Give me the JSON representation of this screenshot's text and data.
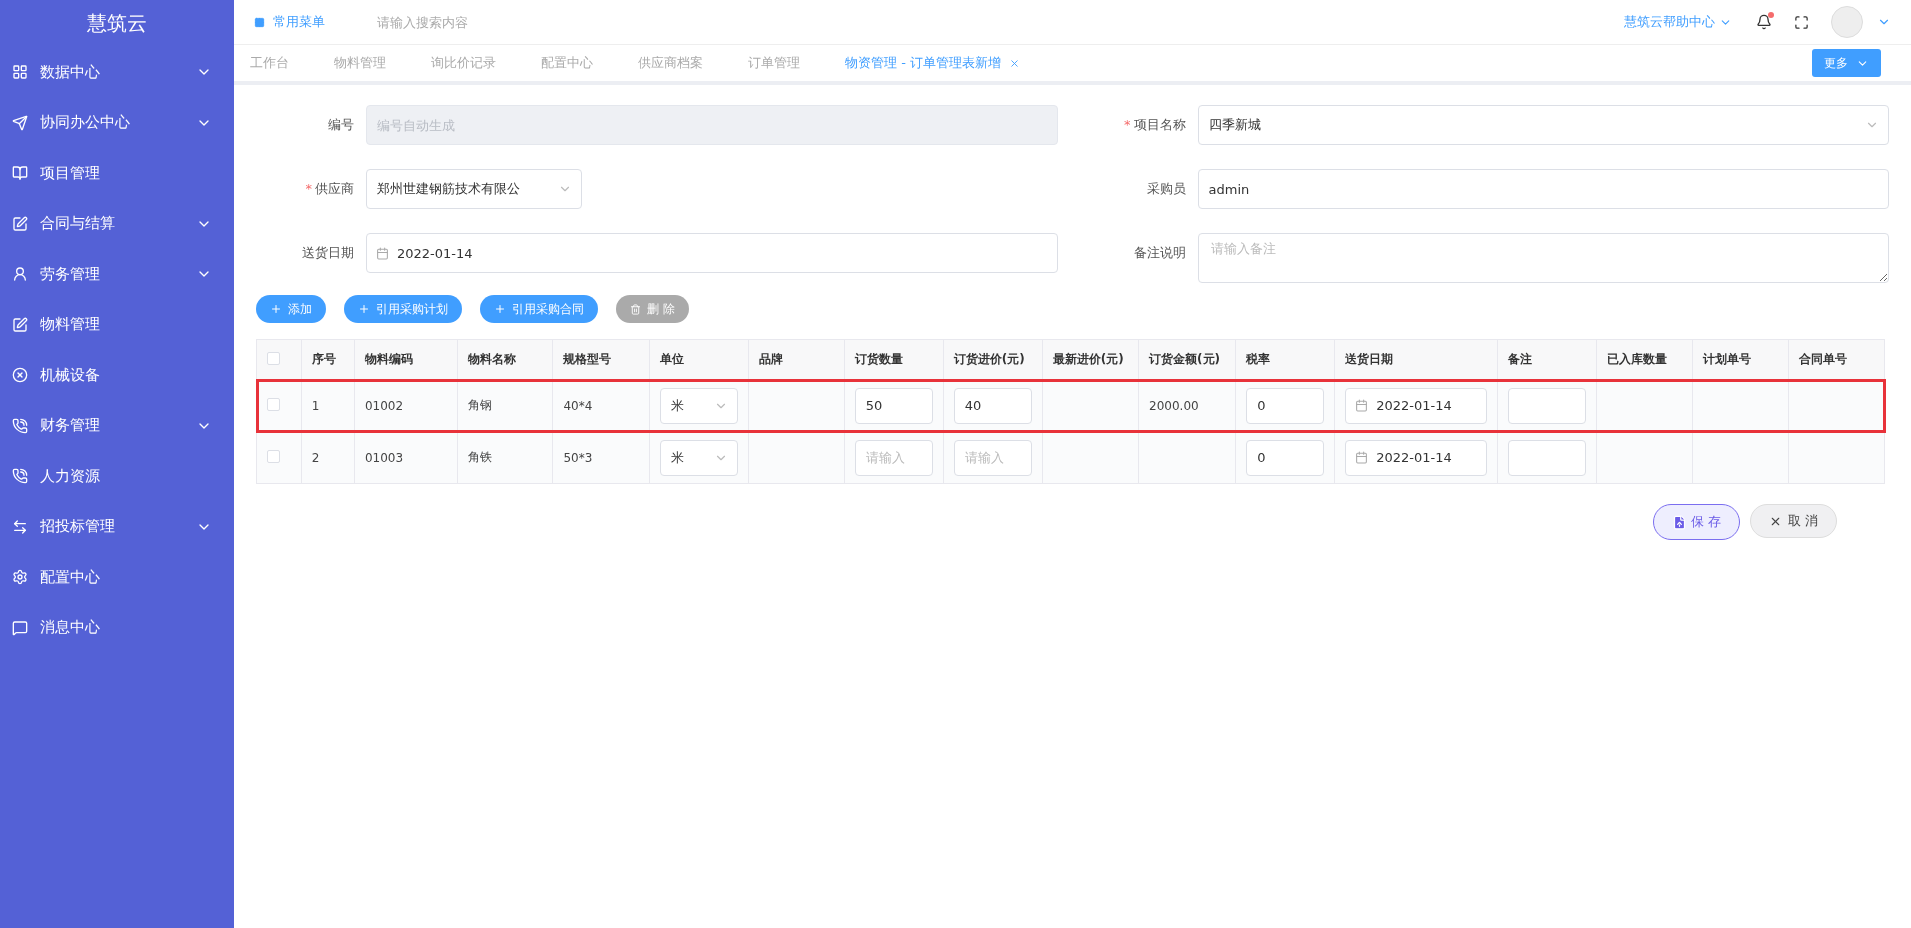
{
  "sidebar": {
    "logo": "慧筑云",
    "items": [
      {
        "label": "数据中心",
        "has_submenu": true
      },
      {
        "label": "协同办公中心",
        "has_submenu": true
      },
      {
        "label": "项目管理",
        "has_submenu": false
      },
      {
        "label": "合同与结算",
        "has_submenu": true
      },
      {
        "label": "劳务管理",
        "has_submenu": true
      },
      {
        "label": "物料管理",
        "has_submenu": false
      },
      {
        "label": "机械设备",
        "has_submenu": false
      },
      {
        "label": "财务管理",
        "has_submenu": true
      },
      {
        "label": "人力资源",
        "has_submenu": false
      },
      {
        "label": "招投标管理",
        "has_submenu": true
      },
      {
        "label": "配置中心",
        "has_submenu": false
      },
      {
        "label": "消息中心",
        "has_submenu": false
      }
    ]
  },
  "header": {
    "menu_label": "常用菜单",
    "search_placeholder": "请输入搜索内容",
    "help_label": "慧筑云帮助中心",
    "has_notification": true
  },
  "tabs": [
    {
      "label": "工作台",
      "selected": false,
      "closable": false
    },
    {
      "label": "物料管理",
      "selected": false,
      "closable": false
    },
    {
      "label": "询比价记录",
      "selected": false,
      "closable": false
    },
    {
      "label": "配置中心",
      "selected": false,
      "closable": false
    },
    {
      "label": "供应商档案",
      "selected": false,
      "closable": false
    },
    {
      "label": "订单管理",
      "selected": false,
      "closable": false
    },
    {
      "label": "物资管理 - 订单管理表新增",
      "selected": true,
      "closable": true
    }
  ],
  "more_button": "更多",
  "form": {
    "required_mark": "*",
    "fields": [
      {
        "label": "编号",
        "required": false,
        "kind": "input",
        "placeholder": "编号自动生成",
        "disabled": true
      },
      {
        "label": "项目名称",
        "required": true,
        "kind": "select",
        "value": "四季新城"
      },
      {
        "label": "供应商",
        "required": true,
        "kind": "select-small",
        "value": "郑州世建钢筋技术有限公"
      },
      {
        "label": "采购员",
        "required": false,
        "kind": "input",
        "value": "admin"
      },
      {
        "label": "送货日期",
        "required": false,
        "kind": "date",
        "value": "2022-01-14"
      },
      {
        "label": "备注说明",
        "required": false,
        "kind": "textarea",
        "placeholder": "请输入备注"
      }
    ]
  },
  "actions": [
    {
      "label": "添加",
      "kind": "add",
      "disabled": false
    },
    {
      "label": "引用采购计划",
      "kind": "add",
      "disabled": false
    },
    {
      "label": "引用采购合同",
      "kind": "add",
      "disabled": false
    },
    {
      "label": "删 除",
      "kind": "delete",
      "disabled": true
    }
  ],
  "table": {
    "all_checked": false,
    "columns": [
      "序号",
      "物料编码",
      "物料名称",
      "规格型号",
      "单位",
      "品牌",
      "订货数量",
      "订货进价(元)",
      "最新进价(元)",
      "订货金额(元)",
      "税率",
      "送货日期",
      "备注",
      "已入库数量",
      "计划单号",
      "合同单号"
    ],
    "rows": [
      {
        "checked": false,
        "highlighted": true,
        "seq": "1",
        "code": "01002",
        "name": "角钢",
        "spec": "40*4",
        "unit": "米",
        "qty": {
          "value": "50"
        },
        "price": {
          "value": "40"
        },
        "amount": "2000.00",
        "tax": "0",
        "date": "2022-01-14"
      },
      {
        "checked": false,
        "highlighted": false,
        "seq": "2",
        "code": "01003",
        "name": "角铁",
        "spec": "50*3",
        "unit": "米",
        "qty": {
          "placeholder": "请输入"
        },
        "price": {
          "placeholder": "请输入"
        },
        "tax": "0",
        "date": "2022-01-14"
      }
    ]
  },
  "footer": {
    "save": "保 存",
    "cancel": "取 消"
  }
}
